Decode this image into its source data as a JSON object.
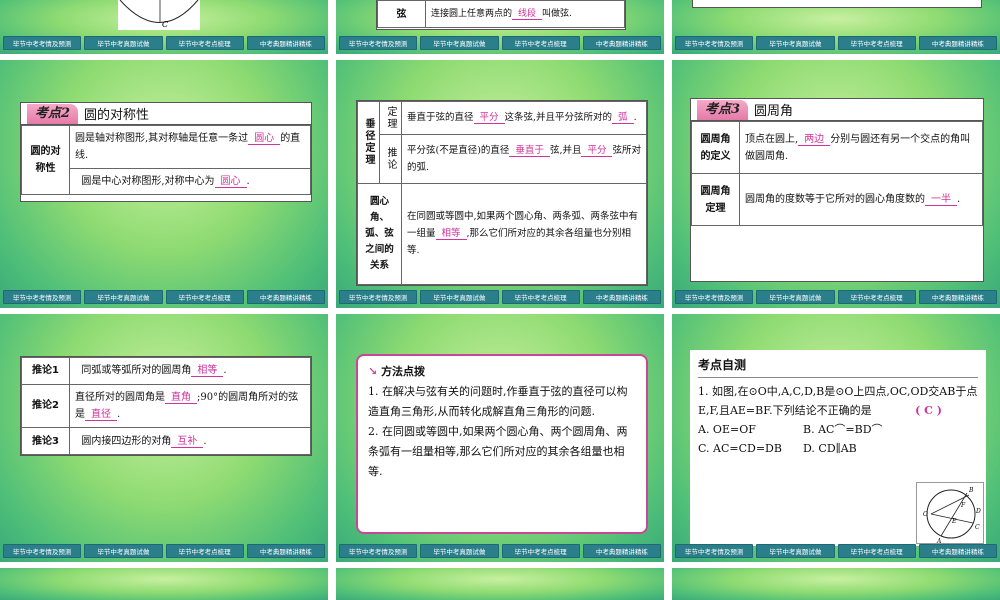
{
  "nav": [
    "毕节中考考情及预测",
    "毕节中考真题试做",
    "毕节中考考点梳理",
    "中考典题精讲精练"
  ],
  "top_row": {
    "middle_term": "弦",
    "middle_text_before": "连接圆上任意两点的",
    "middle_blank": "线段",
    "middle_text_after": "叫做弦."
  },
  "slide_symmetry": {
    "tag": "考点2",
    "title": "圆的对称性",
    "label": "圆的对称性",
    "line1_before": "圆是轴对称图形,其对称轴是任意一条过",
    "line1_blank": "圆心",
    "line1_after": "的直线.",
    "line2_before": "圆是中心对称图形,对称中心为",
    "line2_blank": "圆心",
    "line2_after": "."
  },
  "slide_perpendicular": {
    "group_label": "垂径定理",
    "row1_label": "定理",
    "row1_before": "垂直于弦的直径",
    "row1_blank1": "平分",
    "row1_mid": "这条弦,并且平分弦所对的",
    "row1_blank2": "弧",
    "row1_after": ".",
    "row2_label": "推论",
    "row2_before": "平分弦(不是直径)的直径",
    "row2_blank1": "垂直于",
    "row2_mid": "弦,并且",
    "row2_blank2": "平分",
    "row2_after": "弦所对的弧.",
    "row3_label": "圆心角、弧、弦之间的关系",
    "row3_before": "在同圆或等圆中,如果两个圆心角、两条弧、两条弦中有一组量",
    "row3_blank": "相等",
    "row3_after": ",那么它们所对应的其余各组量也分别相等."
  },
  "slide_inscribed": {
    "tag": "考点3",
    "title": "圆周角",
    "row1_label": "圆周角的定义",
    "row1_before": "顶点在圆上,",
    "row1_blank": "两边",
    "row1_after": "分别与圆还有另一个交点的角叫做圆周角.",
    "row2_label": "圆周角定理",
    "row2_before": "圆周角的度数等于它所对的圆心角度数的",
    "row2_blank": "一半",
    "row2_after": "."
  },
  "slide_corollary": {
    "r1_label": "推论1",
    "r1_before": "同弧或等弧所对的圆周角",
    "r1_blank": "相等",
    "r1_after": ".",
    "r2_label": "推论2",
    "r2_before": "直径所对的圆周角是",
    "r2_blank1": "直角",
    "r2_mid": ";90°的圆周角所对的弦是",
    "r2_blank2": "直径",
    "r2_after": ".",
    "r3_label": "推论3",
    "r3_before": "圆内接四边形的对角",
    "r3_blank": "互补",
    "r3_after": "."
  },
  "slide_method": {
    "title": "方法点拨",
    "p1": "1. 在解决与弦有关的问题时,作垂直于弦的直径可以构造直角三角形,从而转化成解直角三角形的问题.",
    "p2": "2. 在同圆或等圆中,如果两个圆心角、两个圆周角、两条弧有一组量相等,那么它们所对应的其余各组量也相等."
  },
  "slide_quiz": {
    "title": "考点自测",
    "question": "1. 如图,在⊙O中,A,C,D,B是⊙O上四点,OC,OD交AB于点E,F,且AE=BF.下列结论不正确的是",
    "answer": "( C )",
    "optA": "A. OE=OF",
    "optB": "B. AC⌒=BD⌒",
    "optC": "C. AC=CD=DB",
    "optD": "D. CD∥AB",
    "fig_labels": [
      "B",
      "D",
      "F",
      "O",
      "E",
      "C",
      "A"
    ]
  },
  "colors": {
    "accent": "#d0339a",
    "nav_bg": "#2a7f8a",
    "tag_pink": "#e57aa8"
  }
}
